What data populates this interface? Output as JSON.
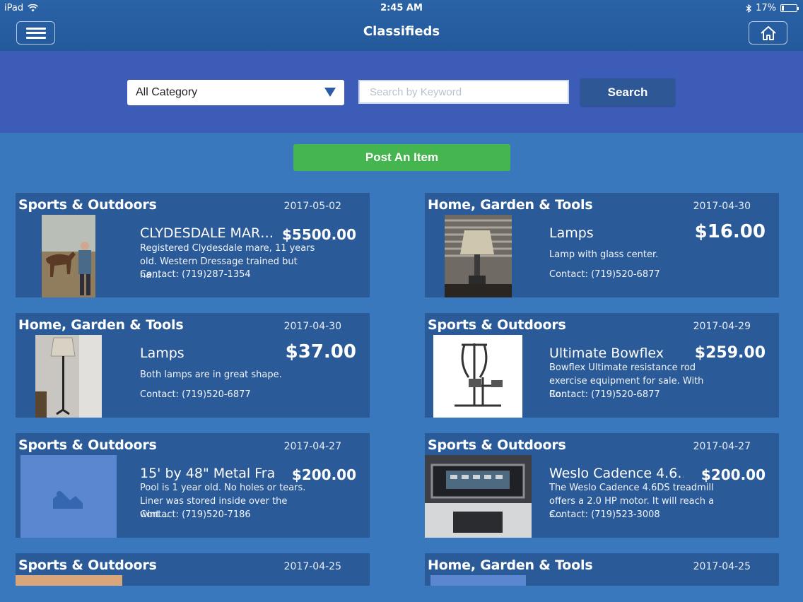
{
  "status": {
    "device": "iPad",
    "time": "2:45 AM",
    "battery": "17%",
    "battery_level": 0.17
  },
  "nav": {
    "title": "Classifieds",
    "menu_icon": "hamburger-icon",
    "home_icon": "home-icon"
  },
  "search": {
    "category_value": "All Category",
    "keyword_placeholder": "Search by Keyword",
    "keyword_value": "",
    "button_label": "Search"
  },
  "post_button_label": "Post An Item",
  "listings": [
    {
      "category": "Sports & Outdoors",
      "date": "2017-05-02",
      "title": "CLYDESDALE MAR…",
      "price": "$5500.00",
      "description": "Registered Clydesdale mare, 11 years old. Western Dressage trained but ha…",
      "contact": "Contact: (719)287-1354"
    },
    {
      "category": "Home, Garden & Tools",
      "date": "2017-04-30",
      "title": "Lamps",
      "price": "$16.00",
      "description": "Lamp with glass center.",
      "contact": "Contact: (719)520-6877"
    },
    {
      "category": "Home, Garden & Tools",
      "date": "2017-04-30",
      "title": "Lamps",
      "price": "$37.00",
      "description": "Both lamps are in great shape.",
      "contact": "Contact: (719)520-6877"
    },
    {
      "category": "Sports & Outdoors",
      "date": "2017-04-29",
      "title": "Ultimate Bowflex",
      "price": "$259.00",
      "description": "Bowflex Ultimate resistance rod exercise equipment for sale. With Ro…",
      "contact": "Contact: (719)520-6877"
    },
    {
      "category": "Sports & Outdoors",
      "date": "2017-04-27",
      "title": "15' by 48\" Metal Fra…",
      "price": "$200.00",
      "description": "Pool is 1 year old.  No holes or tears. Liner was stored inside over the wint…",
      "contact": "Contact: (719)520-7186"
    },
    {
      "category": "Sports & Outdoors",
      "date": "2017-04-27",
      "title": "Weslo Cadence 4.6…",
      "price": "$200.00",
      "description": "The Weslo Cadence 4.6DS treadmill offers a 2.0 HP motor. It will reach a s…",
      "contact": "Contact: (719)523-3008"
    },
    {
      "category": "Sports & Outdoors",
      "date": "2017-04-25"
    },
    {
      "category": "Home, Garden & Tools",
      "date": "2017-04-25"
    }
  ]
}
